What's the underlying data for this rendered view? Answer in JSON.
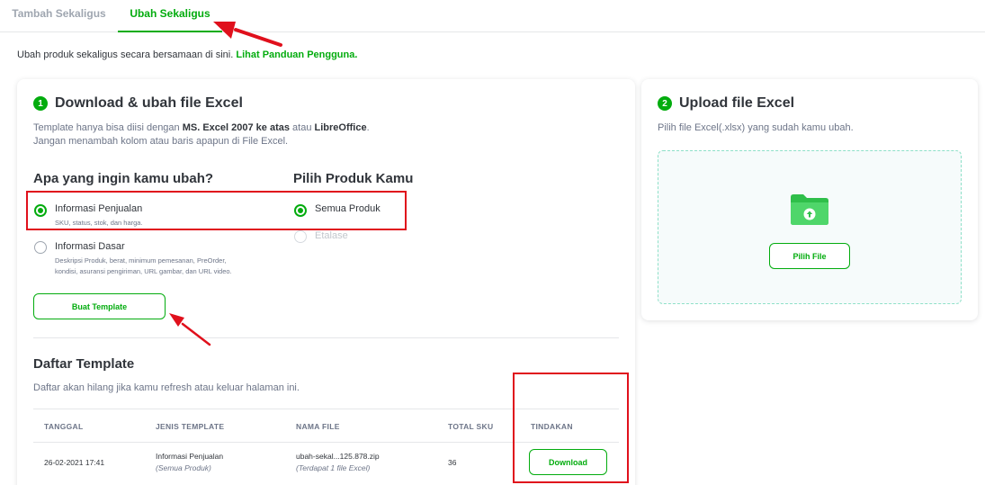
{
  "tabs": [
    {
      "label": "Tambah Sekaligus",
      "active": false
    },
    {
      "label": "Ubah Sekaligus",
      "active": true
    }
  ],
  "intro": {
    "text": "Ubah produk sekaligus secara bersamaan di sini. ",
    "link": "Lihat Panduan Pengguna."
  },
  "step1": {
    "number": "1",
    "title": "Download & ubah file Excel",
    "desc1_a": "Template hanya bisa diisi dengan ",
    "desc1_b": "MS. Excel 2007 ke atas",
    "desc1_c": " atau ",
    "desc1_d": "LibreOffice",
    "desc1_e": ".",
    "desc2": "Jangan menambah kolom atau baris apapun di File Excel."
  },
  "what_to_change": {
    "heading": "Apa yang ingin kamu ubah?",
    "options": [
      {
        "label": "Informasi Penjualan",
        "sub": "SKU, status, stok, dan harga.",
        "selected": true
      },
      {
        "label": "Informasi Dasar",
        "sub1": "Deskripsi Produk, berat, minimum pemesanan, PreOrder,",
        "sub2": "kondisi, asuransi pengiriman, URL gambar, dan URL video.",
        "selected": false
      }
    ]
  },
  "choose_product": {
    "heading": "Pilih Produk Kamu",
    "options": [
      {
        "label": "Semua Produk",
        "selected": true,
        "disabled": false
      },
      {
        "label": "Etalase",
        "selected": false,
        "disabled": true
      }
    ]
  },
  "buttons": {
    "make_template": "Buat Template",
    "download": "Download",
    "choose_file": "Pilih File"
  },
  "template_list": {
    "title": "Daftar Template",
    "desc": "Daftar akan hilang jika kamu refresh atau keluar halaman ini.",
    "columns": [
      "TANGGAL",
      "JENIS TEMPLATE",
      "NAMA FILE",
      "TOTAL SKU",
      "TINDAKAN"
    ],
    "rows": [
      {
        "date": "26-02-2021 17:41",
        "type": "Informasi Penjualan",
        "type_sub": "(Semua Produk)",
        "file": "ubah-sekal...125.878.zip",
        "file_sub": "(Terdapat 1 file Excel)",
        "total_sku": "36"
      }
    ]
  },
  "step2": {
    "number": "2",
    "title": "Upload file Excel",
    "desc": "Pilih file Excel(.xlsx) yang sudah kamu ubah."
  },
  "colors": {
    "accent": "#03ac0e",
    "annotation": "#e0101c"
  }
}
